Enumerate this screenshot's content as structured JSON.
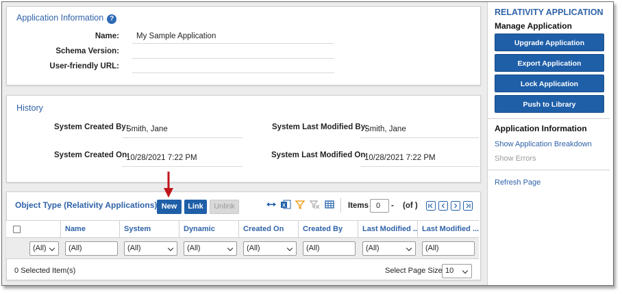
{
  "app_info": {
    "title": "Application Information",
    "help_glyph": "?",
    "fields": [
      {
        "label": "Name:",
        "value": "My Sample Application"
      },
      {
        "label": "Schema Version:",
        "value": ""
      },
      {
        "label": "User-friendly URL:",
        "value": ""
      }
    ]
  },
  "history": {
    "title": "History",
    "created_by_label": "System Created By:",
    "created_by_value": "Smith, Jane",
    "modified_by_label": "System Last Modified By:",
    "modified_by_value": "Smith, Jane",
    "created_on_label": "System Created On:",
    "created_on_value": "10/28/2021 7:22 PM",
    "modified_on_label": "System Last Modified On:",
    "modified_on_value": "10/28/2021 7:22 PM"
  },
  "object_type": {
    "title": "Object Type (Relativity Applications)",
    "buttons": {
      "new": "New",
      "link": "Link",
      "unlink": "Unlink"
    },
    "items_label": "Items",
    "items_value": "0",
    "items_dash": "-",
    "items_of": "(of )",
    "columns": [
      "Name",
      "System",
      "Dynamic",
      "Created On",
      "Created By",
      "Last Modified ...",
      "Last Modified ..."
    ],
    "filter_all": "(All)",
    "selected_count": "0",
    "selected_label": "Selected Item(s)",
    "page_size_label": "Select Page Size:",
    "page_size_value": "10",
    "arrow_color": "#c0151b"
  },
  "sidebar": {
    "title": "RELATIVITY APPLICATION",
    "manage_heading": "Manage Application",
    "buttons": [
      "Upgrade Application",
      "Export Application",
      "Lock Application",
      "Push to Library"
    ],
    "info_heading": "Application Information",
    "links": [
      "Show Application Breakdown",
      "Show Errors"
    ],
    "refresh": "Refresh Page"
  },
  "colors": {
    "accent": "#2f62a8",
    "button": "#1f5fa8"
  }
}
